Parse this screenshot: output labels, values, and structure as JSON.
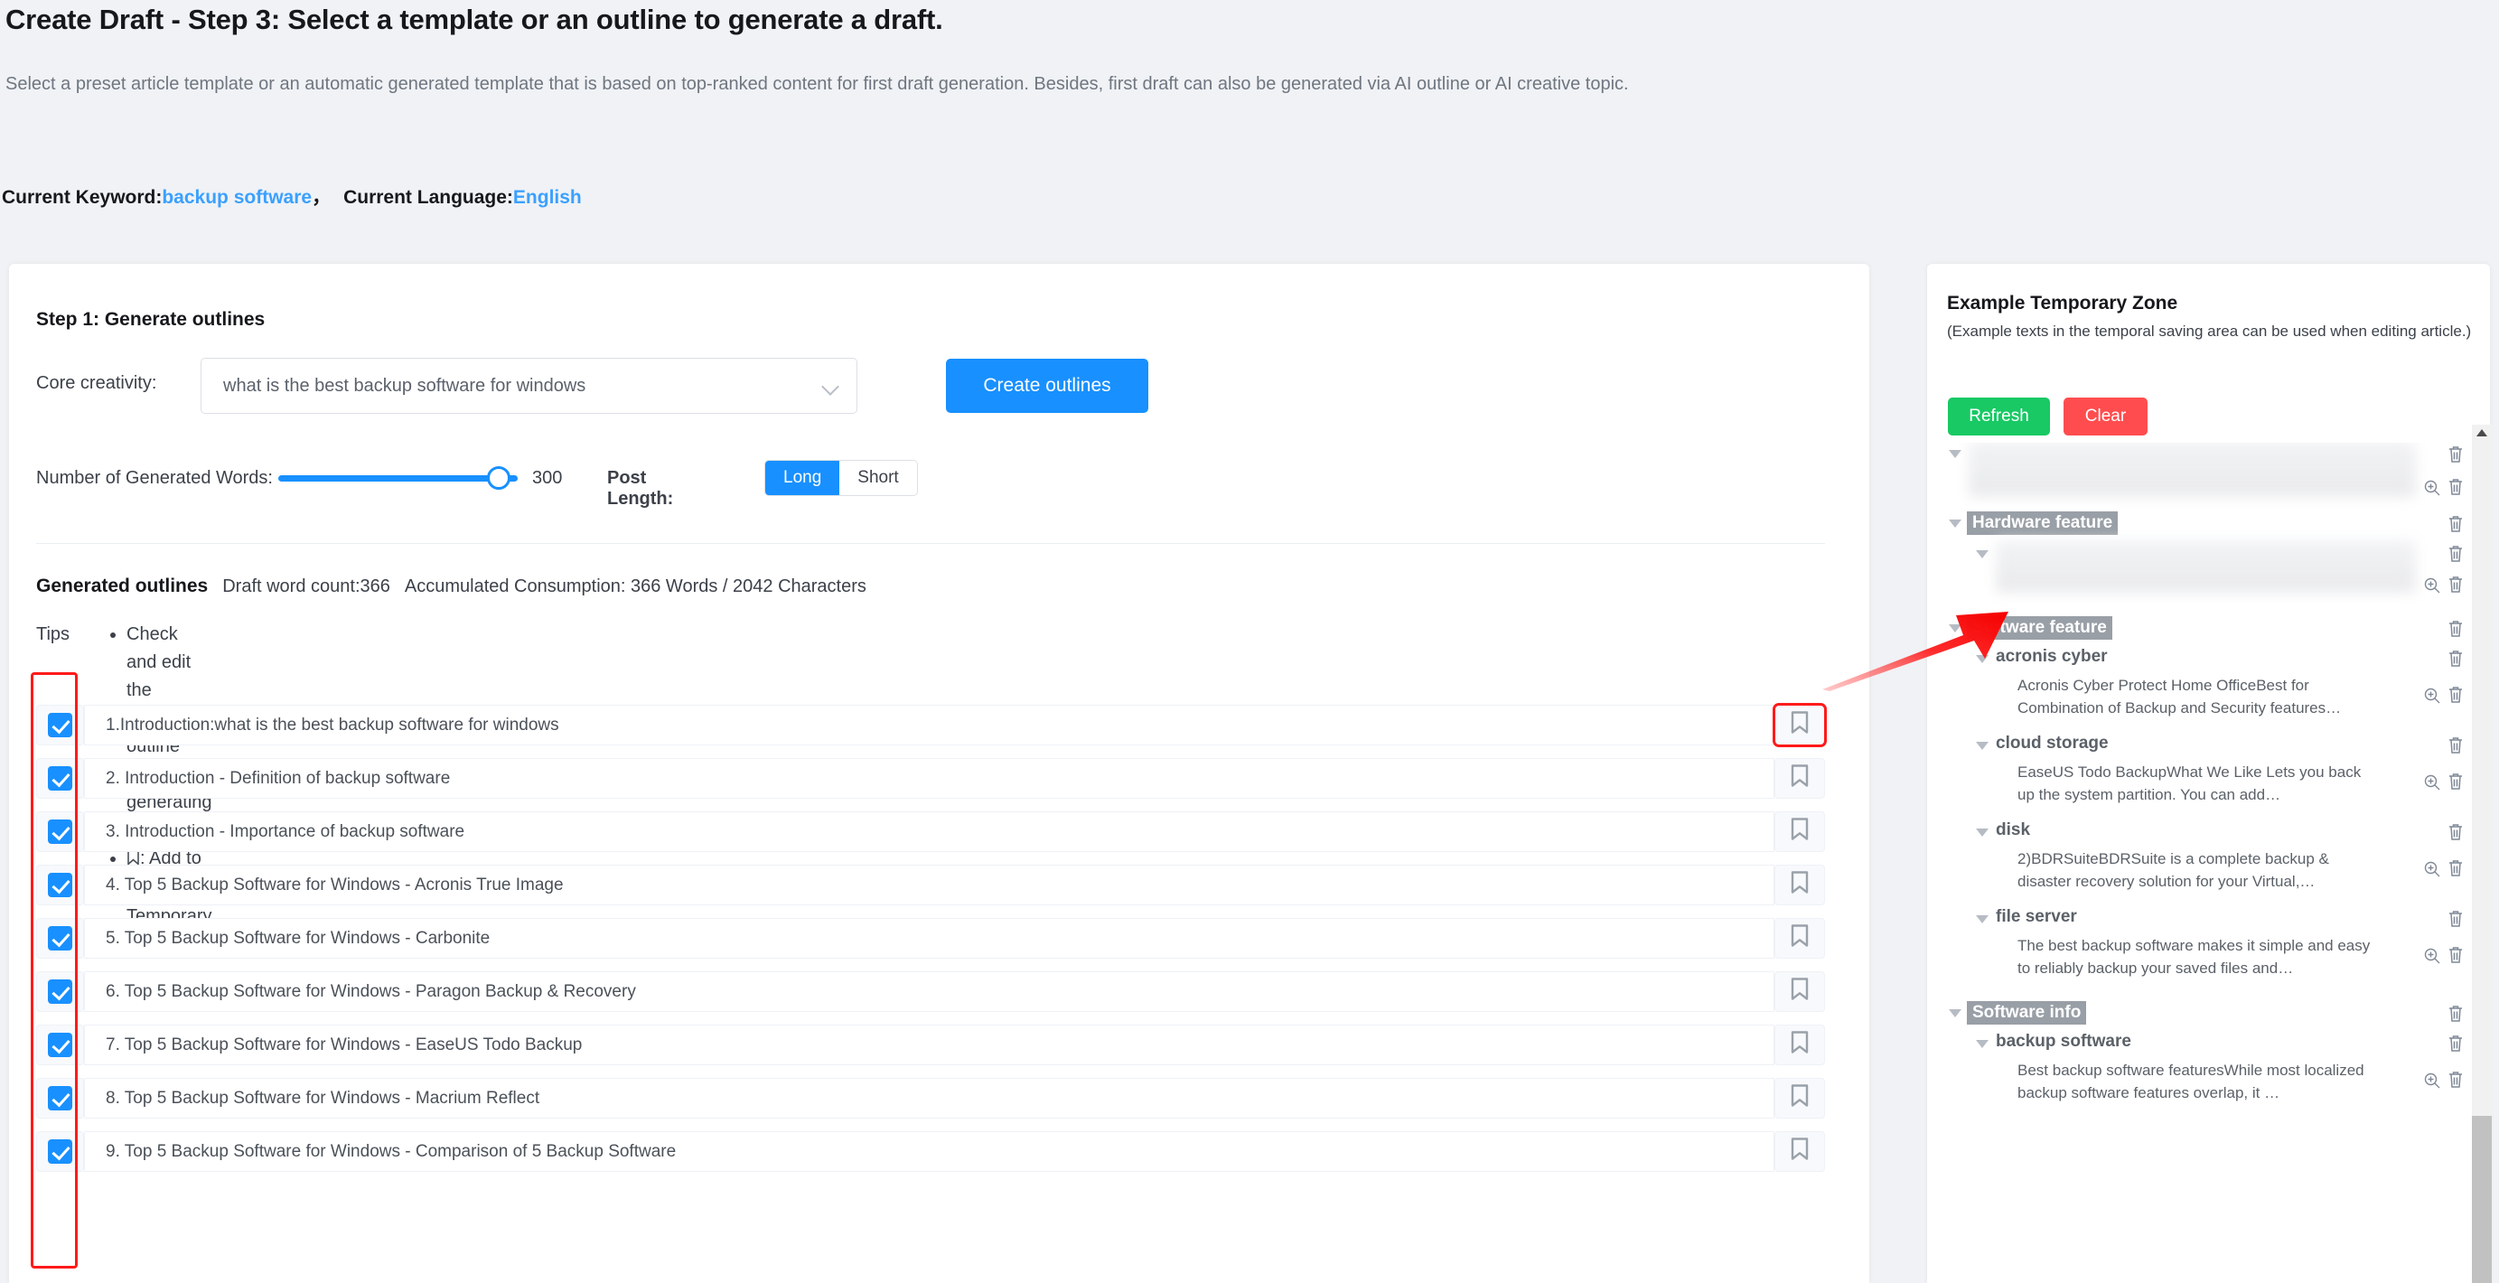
{
  "header": {
    "title": "Create Draft - Step 3: Select a template or an outline to generate a draft.",
    "subtitle": "Select a preset article template or an automatic generated template that is based on top-ranked content for first draft generation. Besides, first draft can also be generated via AI outline or AI creative topic.",
    "keyword_label": "Current Keyword:",
    "keyword_value": "backup software",
    "comma": "，",
    "language_label": "Current Language:",
    "language_value": "English"
  },
  "step1": {
    "title": "Step 1: Generate outlines",
    "core_creativity_label": "Core creativity:",
    "core_creativity_value": "what is the best backup software for windows",
    "create_outlines_label": "Create outlines",
    "words_label": "Number of Generated Words:",
    "words_value": "300",
    "post_length_label": "Post Length:",
    "post_length_options": [
      "Long",
      "Short"
    ],
    "post_length_selected": "Long"
  },
  "outlines": {
    "title": "Generated outlines",
    "draft_word_count": "Draft word count:366",
    "consumption": "Accumulated Consumption: 366 Words  /  2042 Characters",
    "tips_label": "Tips",
    "tips": [
      "Check and edit the required outline items for generating a draft.",
      ": Add to Example Temporary Zone"
    ],
    "items": [
      {
        "text": "1.Introduction:what is the best backup software for windows",
        "checked": true,
        "highlight": true
      },
      {
        "text": "2. Introduction - Definition of backup software",
        "checked": true,
        "highlight": false
      },
      {
        "text": "3. Introduction - Importance of backup software",
        "checked": true,
        "highlight": false
      },
      {
        "text": "4. Top 5 Backup Software for Windows - Acronis True Image",
        "checked": true,
        "highlight": false
      },
      {
        "text": "5. Top 5 Backup Software for Windows - Carbonite",
        "checked": true,
        "highlight": false
      },
      {
        "text": "6. Top 5 Backup Software for Windows - Paragon Backup & Recovery",
        "checked": true,
        "highlight": false
      },
      {
        "text": "7. Top 5 Backup Software for Windows - EaseUS Todo Backup",
        "checked": true,
        "highlight": false
      },
      {
        "text": "8. Top 5 Backup Software for Windows - Macrium Reflect",
        "checked": true,
        "highlight": false
      },
      {
        "text": "9. Top 5 Backup Software for Windows - Comparison of 5 Backup Software",
        "checked": true,
        "highlight": false
      }
    ]
  },
  "sidebar": {
    "title": "Example Temporary Zone",
    "subtitle": "(Example texts in the temporal saving area can be used when editing article.)",
    "refresh_label": "Refresh",
    "clear_label": "Clear",
    "tree": [
      {
        "type": "group-blurred",
        "label": "",
        "children": [
          {
            "type": "leaf-blurred",
            "text": ""
          }
        ]
      },
      {
        "type": "group",
        "label": "Hardware feature",
        "children": [
          {
            "type": "sub-blurred",
            "label": "",
            "children": [
              {
                "type": "leaf-blurred",
                "text": ""
              }
            ]
          }
        ]
      },
      {
        "type": "group",
        "label": "Software feature",
        "children": [
          {
            "type": "sub",
            "label": "acronis cyber",
            "children": [
              {
                "type": "leaf",
                "text": "Acronis Cyber Protect Home OfficeBest for Combination of Backup and Security features…"
              }
            ]
          },
          {
            "type": "sub",
            "label": "cloud storage",
            "children": [
              {
                "type": "leaf",
                "text": "EaseUS Todo BackupWhat We Like Lets you back up the system partition. You can add…"
              }
            ]
          },
          {
            "type": "sub",
            "label": "disk",
            "children": [
              {
                "type": "leaf",
                "text": "2)BDRSuiteBDRSuite is a complete backup & disaster recovery solution for your Virtual,…"
              }
            ]
          },
          {
            "type": "sub",
            "label": "file server",
            "children": [
              {
                "type": "leaf",
                "text": "The best backup software makes it simple and easy to reliably backup your saved files and…"
              }
            ]
          }
        ]
      },
      {
        "type": "group",
        "label": "Software info",
        "children": [
          {
            "type": "sub",
            "label": "backup software",
            "children": [
              {
                "type": "leaf",
                "text": "Best backup software featuresWhile most localized backup software features overlap, it …"
              }
            ]
          }
        ]
      }
    ]
  },
  "colors": {
    "accent_blue": "#1890ff",
    "link_blue": "#3ba0ff",
    "green": "#18c964",
    "red": "#ff4d4f",
    "highlight_red": "#ff1a1a",
    "page_bg": "#f0f2f5"
  }
}
